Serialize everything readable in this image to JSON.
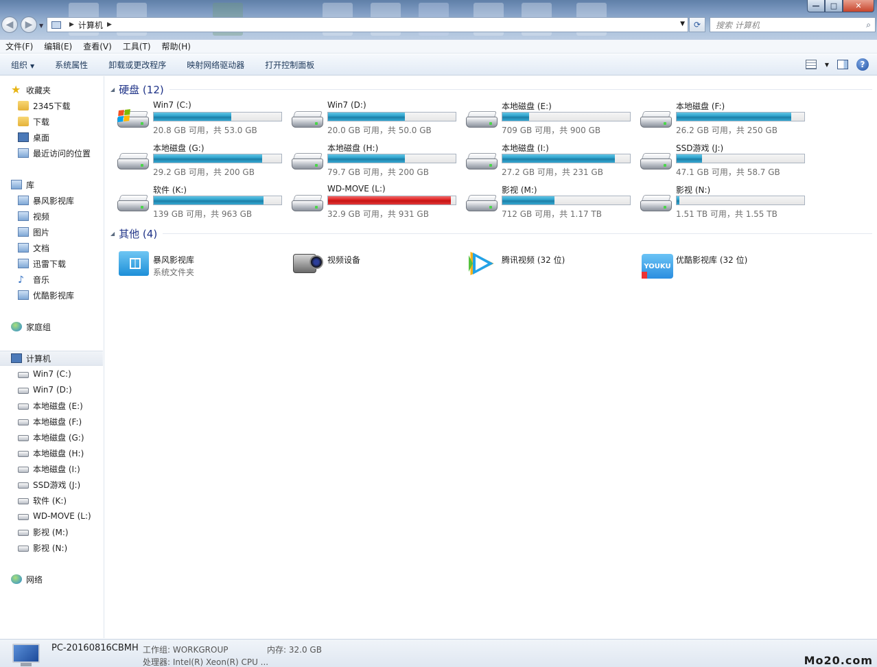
{
  "window": {
    "address": [
      "计算机"
    ],
    "search_placeholder": "搜索 计算机",
    "buttons": {
      "min": "—",
      "max": "□",
      "close": "✕"
    }
  },
  "menu": [
    "文件(F)",
    "编辑(E)",
    "查看(V)",
    "工具(T)",
    "帮助(H)"
  ],
  "commands": {
    "organize": "组织",
    "items": [
      "系统属性",
      "卸载或更改程序",
      "映射网络驱动器",
      "打开控制面板"
    ]
  },
  "sidebar": {
    "favorites": {
      "title": "收藏夹",
      "items": [
        "2345下载",
        "下载",
        "桌面",
        "最近访问的位置"
      ]
    },
    "libraries": {
      "title": "库",
      "items": [
        "暴风影视库",
        "视频",
        "图片",
        "文档",
        "迅雷下载",
        "音乐",
        "优酷影视库"
      ]
    },
    "homegroup": "家庭组",
    "computer": {
      "title": "计算机",
      "items": [
        "Win7 (C:)",
        "Win7 (D:)",
        "本地磁盘 (E:)",
        "本地磁盘 (F:)",
        "本地磁盘 (G:)",
        "本地磁盘 (H:)",
        "本地磁盘 (I:)",
        "SSD游戏 (J:)",
        "软件 (K:)",
        "WD-MOVE (L:)",
        "影视 (M:)",
        "影视 (N:)"
      ]
    },
    "network": "网络"
  },
  "groups": {
    "hdd": "硬盘 (12)",
    "other": "其他 (4)"
  },
  "drives": [
    {
      "name": "Win7 (C:)",
      "info": "20.8 GB 可用，共 53.0 GB",
      "used": 0.61,
      "status": "normal",
      "icon": "windows-drive-icon"
    },
    {
      "name": "Win7 (D:)",
      "info": "20.0 GB 可用，共 50.0 GB",
      "used": 0.6,
      "status": "normal",
      "icon": "hard-drive-icon"
    },
    {
      "name": "本地磁盘 (E:)",
      "info": "709 GB 可用，共 900 GB",
      "used": 0.21,
      "status": "normal",
      "icon": "hard-drive-icon"
    },
    {
      "name": "本地磁盘 (F:)",
      "info": "26.2 GB 可用，共 250 GB",
      "used": 0.9,
      "status": "normal",
      "icon": "hard-drive-icon"
    },
    {
      "name": "本地磁盘 (G:)",
      "info": "29.2 GB 可用，共 200 GB",
      "used": 0.85,
      "status": "normal",
      "icon": "hard-drive-icon"
    },
    {
      "name": "本地磁盘 (H:)",
      "info": "79.7 GB 可用，共 200 GB",
      "used": 0.6,
      "status": "normal",
      "icon": "hard-drive-icon"
    },
    {
      "name": "本地磁盘 (I:)",
      "info": "27.2 GB 可用，共 231 GB",
      "used": 0.88,
      "status": "normal",
      "icon": "hard-drive-icon"
    },
    {
      "name": "SSD游戏 (J:)",
      "info": "47.1 GB 可用，共 58.7 GB",
      "used": 0.2,
      "status": "normal",
      "icon": "hard-drive-icon"
    },
    {
      "name": "软件 (K:)",
      "info": "139 GB 可用，共 963 GB",
      "used": 0.86,
      "status": "normal",
      "icon": "hard-drive-icon"
    },
    {
      "name": "WD-MOVE (L:)",
      "info": "32.9 GB 可用，共 931 GB",
      "used": 0.96,
      "status": "critical",
      "icon": "hard-drive-icon"
    },
    {
      "name": "影视 (M:)",
      "info": "712 GB 可用，共 1.17 TB",
      "used": 0.41,
      "status": "normal",
      "icon": "hard-drive-icon"
    },
    {
      "name": "影视 (N:)",
      "info": "1.51 TB 可用，共 1.55 TB",
      "used": 0.02,
      "status": "normal",
      "icon": "hard-drive-icon"
    }
  ],
  "others": [
    {
      "name": "暴风影视库",
      "sub": "系统文件夹",
      "icon": "baofeng-library-icon"
    },
    {
      "name": "视频设备",
      "sub": "",
      "icon": "video-camera-icon"
    },
    {
      "name": "腾讯视频 (32 位)",
      "sub": "",
      "icon": "tencent-video-icon"
    },
    {
      "name": "优酷影视库 (32 位)",
      "sub": "",
      "icon": "youku-library-icon",
      "logo_text": "YOUKU"
    }
  ],
  "status": {
    "pc_name": "PC-20160816CBMH",
    "workgroup": "工作组: WORKGROUP",
    "memory": "内存: 32.0 GB",
    "cpu": "处理器: Intel(R) Xeon(R) CPU ..."
  },
  "watermark": "Mo20.com",
  "colors": {
    "bar_normal": "#2a9ec9",
    "bar_critical": "#dc2020",
    "group_title": "#1e3287"
  }
}
